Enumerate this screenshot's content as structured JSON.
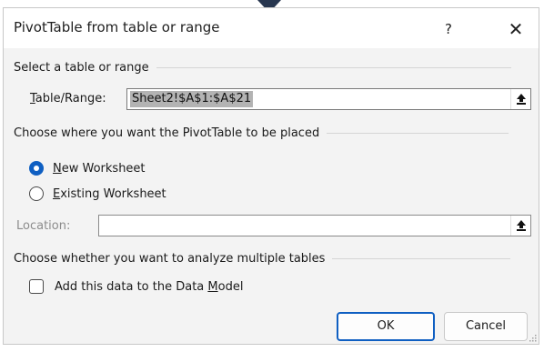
{
  "dialog": {
    "title": "PivotTable from table or range",
    "help_label": "?",
    "close_label": "✕"
  },
  "source": {
    "section_label": "Select a table or range",
    "field_label_accel": "T",
    "field_label_rest": "able/Range:",
    "value": "Sheet2!$A$1:$A$21"
  },
  "placement": {
    "section_label": "Choose where you want the PivotTable to be placed",
    "options": [
      {
        "accel": "N",
        "rest": "ew Worksheet",
        "checked": true
      },
      {
        "accel": "E",
        "rest": "xisting Worksheet",
        "checked": false
      }
    ],
    "location_label": "Location:",
    "location_value": ""
  },
  "analyze": {
    "section_label": "Choose whether you want to analyze multiple tables",
    "checkbox_prefix": "Add this data to the Data ",
    "checkbox_accel": "M",
    "checkbox_suffix": "odel",
    "checked": false
  },
  "buttons": {
    "ok": "OK",
    "cancel": "Cancel"
  },
  "colors": {
    "accent": "#0f5fc2",
    "selection": "#b3b3b3",
    "pointer": "#27364f"
  },
  "icons": [
    "collapse-dialog-icon",
    "close-icon",
    "help-icon",
    "resize-grip-icon"
  ]
}
